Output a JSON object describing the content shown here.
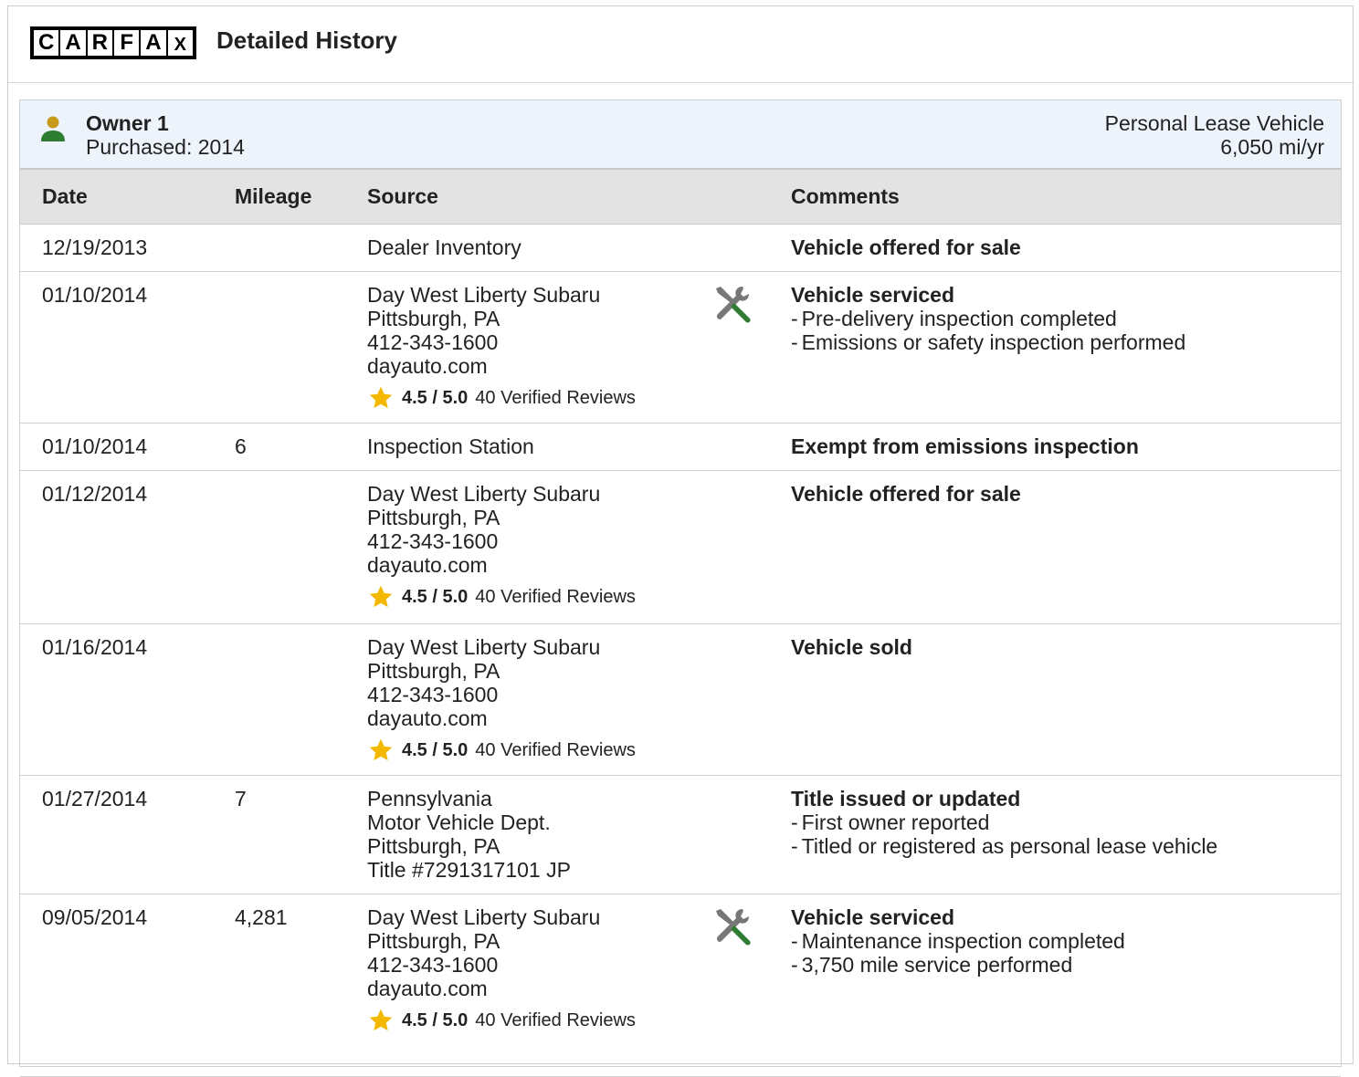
{
  "header": {
    "logo_letters": [
      "C",
      "A",
      "R",
      "F",
      "A",
      "X"
    ],
    "title": "Detailed History"
  },
  "owner": {
    "title": "Owner 1",
    "purchased": "Purchased: 2014",
    "vehicle_type": "Personal Lease Vehicle",
    "mileage_rate": "6,050 mi/yr",
    "icon": "person-icon",
    "icon_colors": {
      "head": "#c79a1a",
      "body": "#2e7d32"
    }
  },
  "columns": {
    "date": "Date",
    "mileage": "Mileage",
    "source": "Source",
    "comments": "Comments"
  },
  "rating_colors": {
    "star": "#f5b800"
  },
  "service_icon_colors": {
    "wrench": "#777777",
    "screwdriver": "#2e7d32"
  },
  "records": [
    {
      "date": "12/19/2013",
      "mileage": "",
      "source": [
        "Dealer Inventory"
      ],
      "rating": null,
      "service_icon": false,
      "comment_title": "Vehicle offered for sale",
      "comment_items": []
    },
    {
      "date": "01/10/2014",
      "mileage": "",
      "source": [
        "Day West Liberty Subaru",
        "Pittsburgh, PA",
        "412-343-1600",
        "dayauto.com"
      ],
      "rating": {
        "score": "4.5 / 5.0",
        "reviews": "40 Verified Reviews"
      },
      "service_icon": true,
      "comment_title": "Vehicle serviced",
      "comment_items": [
        "Pre-delivery inspection completed",
        "Emissions or safety inspection performed"
      ]
    },
    {
      "date": "01/10/2014",
      "mileage": "6",
      "source": [
        "Inspection Station"
      ],
      "rating": null,
      "service_icon": false,
      "comment_title": "Exempt from emissions inspection",
      "comment_items": []
    },
    {
      "date": "01/12/2014",
      "mileage": "",
      "source": [
        "Day West Liberty Subaru",
        "Pittsburgh, PA",
        "412-343-1600",
        "dayauto.com"
      ],
      "rating": {
        "score": "4.5 / 5.0",
        "reviews": "40 Verified Reviews"
      },
      "service_icon": false,
      "comment_title": "Vehicle offered for sale",
      "comment_items": []
    },
    {
      "date": "01/16/2014",
      "mileage": "",
      "source": [
        "Day West Liberty Subaru",
        "Pittsburgh, PA",
        "412-343-1600",
        "dayauto.com"
      ],
      "rating": {
        "score": "4.5 / 5.0",
        "reviews": "40 Verified Reviews"
      },
      "service_icon": false,
      "comment_title": "Vehicle sold",
      "comment_items": []
    },
    {
      "date": "01/27/2014",
      "mileage": "7",
      "source": [
        "Pennsylvania",
        "Motor Vehicle Dept.",
        "Pittsburgh, PA",
        "Title #7291317101 JP"
      ],
      "rating": null,
      "service_icon": false,
      "comment_title": "Title issued or updated",
      "comment_items": [
        "First owner reported",
        "Titled or registered as personal lease vehicle"
      ]
    },
    {
      "date": "09/05/2014",
      "mileage": "4,281",
      "source": [
        "Day West Liberty Subaru",
        "Pittsburgh, PA",
        "412-343-1600",
        "dayauto.com"
      ],
      "rating": {
        "score": "4.5 / 5.0",
        "reviews": "40 Verified Reviews"
      },
      "service_icon": true,
      "comment_title": "Vehicle serviced",
      "comment_items": [
        "Maintenance inspection completed",
        "3,750 mile service performed"
      ]
    }
  ]
}
